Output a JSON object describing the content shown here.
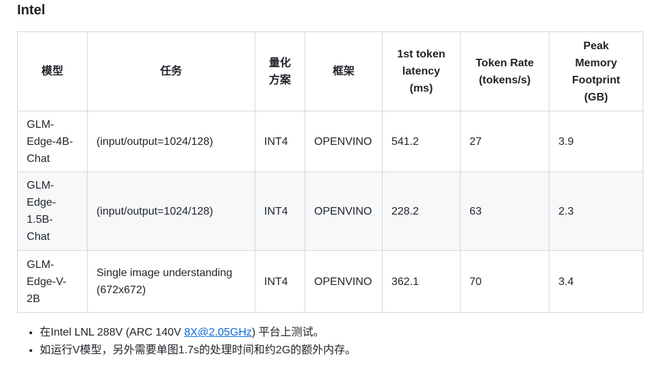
{
  "title": "Intel",
  "headers": [
    "模型",
    "任务",
    "量化方案",
    "框架",
    "1st token latency (ms)",
    "Token Rate (tokens/s)",
    "Peak Memory Footprint (GB)"
  ],
  "rows": [
    [
      "GLM-Edge-4B-Chat",
      "(input/output=1024/128)",
      "INT4",
      "OPENVINO",
      "541.2",
      "27",
      "3.9"
    ],
    [
      "GLM-Edge-1.5B-Chat",
      "(input/output=1024/128)",
      "INT4",
      "OPENVINO",
      "228.2",
      "63",
      "2.3"
    ],
    [
      "GLM-Edge-V-2B",
      "Single image understanding (672x672)",
      "INT4",
      "OPENVINO",
      "362.1",
      "70",
      "3.4"
    ]
  ],
  "notes": {
    "n1_pre": "在Intel LNL 288V (ARC 140V ",
    "n1_link": "8X@2.05GHz",
    "n1_post": ") 平台上测试。",
    "n2": "如运行V模型，另外需要单图1.7s的处理时间和约2G的额外内存。"
  }
}
